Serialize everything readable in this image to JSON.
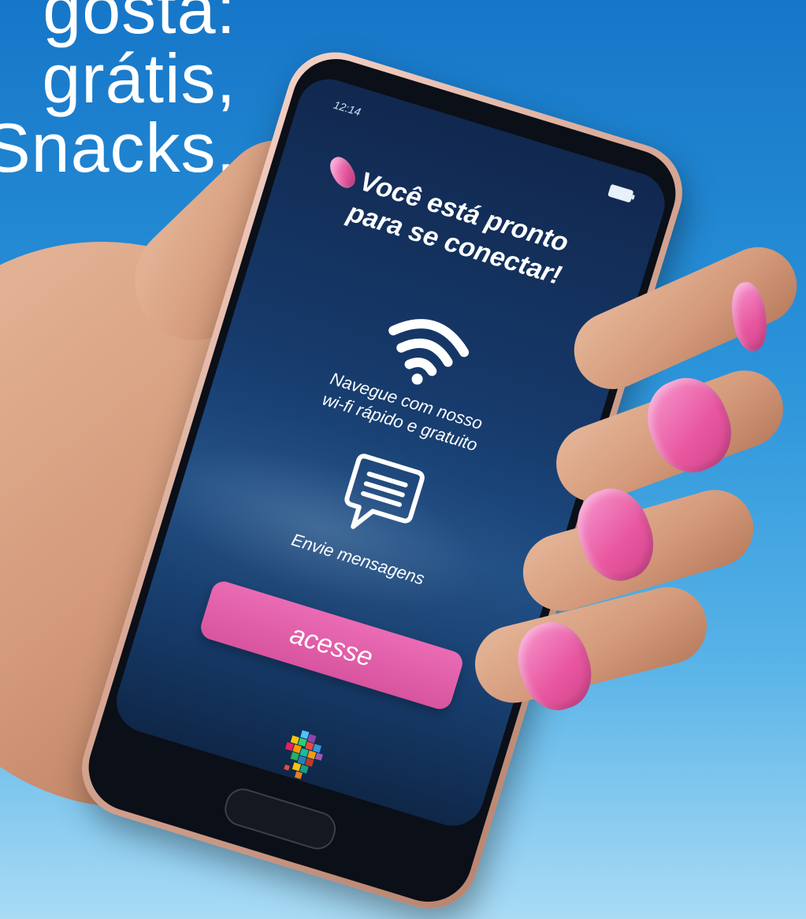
{
  "headline": {
    "lines": [
      "gosta:",
      "grátis,",
      "Snacks."
    ]
  },
  "phone": {
    "status": {
      "time": "12:14"
    },
    "screen": {
      "title_lines": [
        "Você está pronto",
        "para se conectar!"
      ],
      "wifi_feature": {
        "icon": "wifi-icon",
        "lines": [
          "Navegue com nosso",
          "wi-fi rápido e gratuito"
        ]
      },
      "message_feature": {
        "icon": "message-icon",
        "text": "Envie mensagens"
      },
      "access_button_label": "acesse",
      "brand_logo": "mosaic-map-logo"
    }
  },
  "colors": {
    "sky_top": "#1676c8",
    "sky_bottom": "#a9dbf5",
    "accent_pink": "#e25fa9",
    "nail_pink": "#e8569f",
    "screen_navy": "#163a6b",
    "phone_rose_gold": "#d9aa97"
  }
}
